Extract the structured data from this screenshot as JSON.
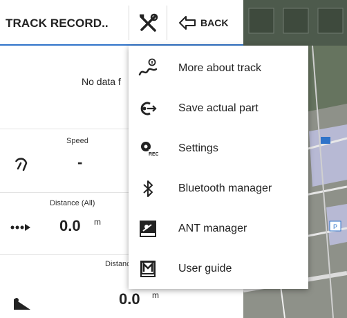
{
  "toolbar": {
    "title": "TRACK RECORD..",
    "back_label": "BACK"
  },
  "panel": {
    "no_data": "No data f",
    "speed_label": "Speed",
    "speed_value": "-",
    "distance_all_label": "Distance (All)",
    "distance_all_value": "0.0",
    "distance_all_unit": "m",
    "distance_label": "Distanc",
    "distance_value": "0.0",
    "distance_unit": "m"
  },
  "menu": {
    "items": [
      {
        "label": "More about track",
        "icon": "track-info-icon"
      },
      {
        "label": "Save actual part",
        "icon": "save-part-icon"
      },
      {
        "label": "Settings",
        "icon": "settings-rec-icon"
      },
      {
        "label": "Bluetooth manager",
        "icon": "bluetooth-icon"
      },
      {
        "label": "ANT manager",
        "icon": "ant-icon"
      },
      {
        "label": "User guide",
        "icon": "user-guide-icon"
      }
    ]
  },
  "colors": {
    "accent": "#2f73c9",
    "map_green": "#5b6a5a"
  }
}
